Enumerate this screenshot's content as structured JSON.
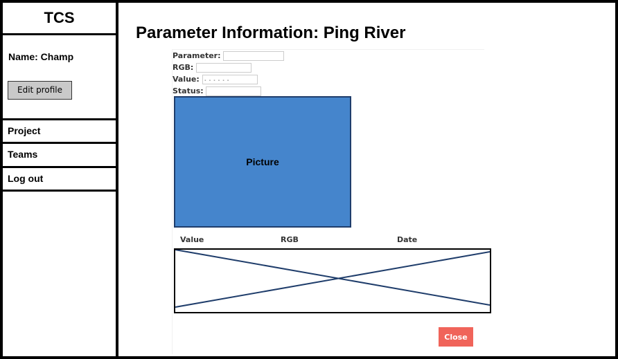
{
  "app": {
    "title": "TCS"
  },
  "user": {
    "name_label": "Name: Champ",
    "edit_profile_label": "Edit profile"
  },
  "nav": {
    "items": [
      {
        "label": "Project"
      },
      {
        "label": "Teams"
      },
      {
        "label": "Log out"
      }
    ]
  },
  "page": {
    "title": "Parameter Information: Ping River"
  },
  "form": {
    "parameter_label": "Parameter:",
    "rgb_label": "RGB:",
    "value_label": "Value:",
    "value_field": ". . . . . .",
    "status_label": "Status:"
  },
  "picture": {
    "label": "Picture"
  },
  "table": {
    "headers": [
      "Value",
      "RGB",
      "Date"
    ]
  },
  "actions": {
    "close_label": "Close"
  },
  "colors": {
    "picture_fill": "#4585cc",
    "close_button": "#f0645a",
    "placeholder_stroke": "#1f3d6b"
  }
}
